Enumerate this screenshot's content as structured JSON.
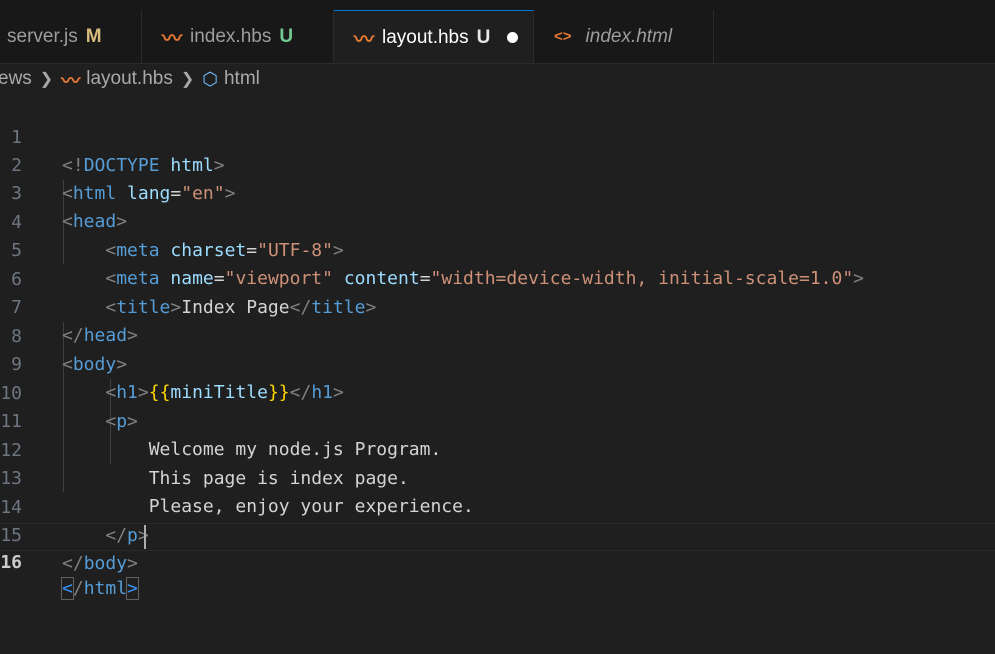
{
  "tabs": [
    {
      "label": "server.js",
      "status": "M",
      "icon": "js-file-icon"
    },
    {
      "label": "index.hbs",
      "status": "U",
      "icon": "handlebars-icon"
    },
    {
      "label": "layout.hbs",
      "status": "U",
      "icon": "handlebars-icon",
      "active": true,
      "unsaved": true
    },
    {
      "label": "index.html",
      "icon": "html-icon",
      "preview": true
    }
  ],
  "breadcrumb": {
    "folder": "ews",
    "file": "layout.hbs",
    "symbol": "html"
  },
  "editor": {
    "current_line": 16,
    "line_numbers": [
      "1",
      "2",
      "3",
      "4",
      "5",
      "6",
      "7",
      "8",
      "9",
      "10",
      "11",
      "12",
      "13",
      "14",
      "15",
      "16"
    ],
    "tokens": {
      "doctype": "DOCTYPE",
      "html": "html",
      "lang": "lang",
      "lang_val": "\"en\"",
      "head": "head",
      "meta": "meta",
      "charset": "charset",
      "charset_val": "\"UTF-8\"",
      "name": "name",
      "name_val": "\"viewport\"",
      "content": "content",
      "content_val": "\"width=device-width, initial-scale=1.0\"",
      "title": "title",
      "title_text": "Index Page",
      "body": "body",
      "h1": "h1",
      "mustache_open": "{{",
      "mustache_var": "miniTitle",
      "mustache_close": "}}",
      "p": "p",
      "p_line1": "Welcome my node.js Program.",
      "p_line2": "This page is index page.",
      "p_line3": "Please, enjoy your experience."
    }
  },
  "colors": {
    "tag": "#569cd6",
    "attribute": "#9cdcfe",
    "string": "#ce9178",
    "punctuation": "#808080",
    "mustache": "#ffd700",
    "hbs_icon": "#e37933"
  }
}
